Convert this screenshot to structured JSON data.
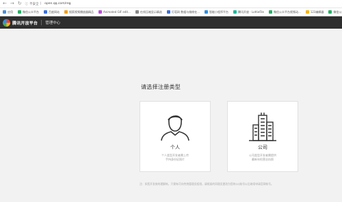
{
  "browser": {
    "security_label": "不安全",
    "url": "open.qq.com/reg",
    "bookmarks": [
      {
        "label": "应用",
        "color": "#4a90d9"
      },
      {
        "label": "微信公众平台",
        "color": "#2aae67"
      },
      {
        "label": "百度网站",
        "color": "#3d6fd9"
      },
      {
        "label": "搜索视频播放器精品",
        "color": "#f0a020"
      },
      {
        "label": "Animated GIF edit...",
        "color": "#b84fd9"
      },
      {
        "label": "在线压缩显示精选",
        "color": "#888888"
      },
      {
        "label": "灯塔网 数据与微商在...",
        "color": "#3d6fd9"
      },
      {
        "label": "智能小程序平台",
        "color": "#2f8fe3"
      },
      {
        "label": "腾讯开放 - LottieFile",
        "color": "#1fb89c"
      },
      {
        "label": "微信公众平台视频动...",
        "color": "#2aae67"
      },
      {
        "label": "123编辑器",
        "color": "#f5b51f"
      },
      {
        "label": "微信公众",
        "color": "#2aae67"
      }
    ]
  },
  "header": {
    "logo_text": "腾讯开放平台",
    "section": "管理中心"
  },
  "main": {
    "title": "请选择注册类型",
    "personal": {
      "name": "个人",
      "desc_line1": "个人类型开发者需上传",
      "desc_line2": "手持身份证照片"
    },
    "company": {
      "name": "公司",
      "desc_line1": "公司类型开发者需提供",
      "desc_line2": "最新年检营业执照"
    },
    "note": "注：如您开发商的理解帐，只需有可向传统管理员权限，请框架的同理员更改为您的QQ账号以后继续申请官网帐号。"
  },
  "colors": {
    "header_bg": "#2e2e2e",
    "page_bg": "#f2f2f2",
    "card_border": "#e0e0e0"
  }
}
